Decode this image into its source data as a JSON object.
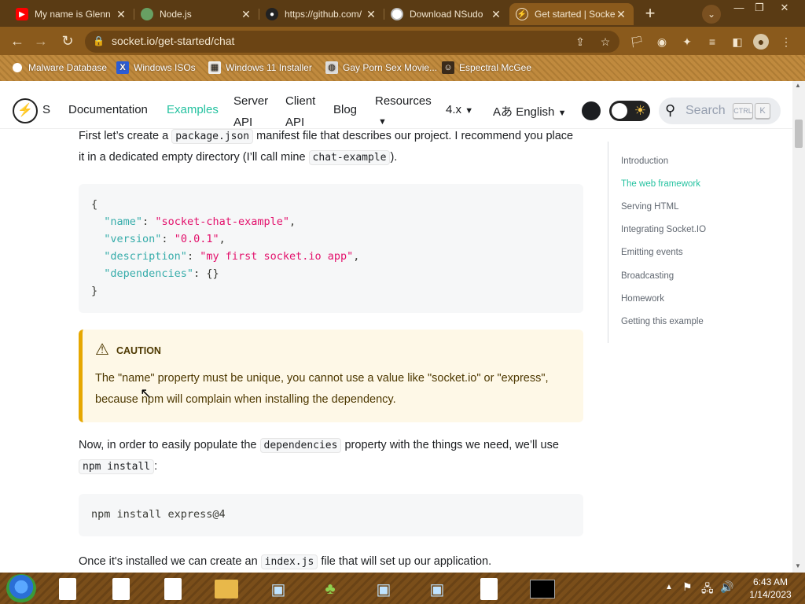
{
  "browser": {
    "tabs": [
      {
        "title": "My name is Glenn",
        "icon": "youtube-icon",
        "color": "#ff0000"
      },
      {
        "title": "Node.js",
        "icon": "nodejs-icon",
        "color": "#68a063"
      },
      {
        "title": "https://github.com/",
        "icon": "github-icon",
        "color": "#222222"
      },
      {
        "title": "Download NSudo",
        "icon": "chrome-icon",
        "color": "#ffffff"
      },
      {
        "title": "Get started | Socket.IO",
        "icon": "socketio-icon",
        "color": "#ffffff"
      }
    ],
    "new_tab": "+",
    "url": "socket.io/get-started/chat",
    "bookmarks": [
      "Malware Database",
      "Windows ISOs",
      "Windows 11 Installer",
      "Gay Porn Sex Movie...",
      "Espectral McGee"
    ]
  },
  "site": {
    "logo_letter": "S",
    "nav": {
      "documentation": "Documentation",
      "examples": "Examples",
      "server_api_1": "Server",
      "server_api_2": "API",
      "client_api_1": "Client",
      "client_api_2": "API",
      "blog": "Blog",
      "resources": "Resources",
      "version": "4.x",
      "language": "English"
    },
    "search_placeholder": "Search",
    "search_kbd": [
      "CTRL",
      "K"
    ]
  },
  "content": {
    "p1": {
      "a": "First let’s create a ",
      "code1": "package.json",
      "b": " manifest file that describes our project. I recommend you place",
      "c": "it in a dedicated empty directory (I’ll call mine ",
      "code2": "chat-example",
      "d": ")."
    },
    "code_json": {
      "l1": "{",
      "l2_key": "\"name\"",
      "l2_val": "\"socket-chat-example\"",
      "l3_key": "\"version\"",
      "l3_val": "\"0.0.1\"",
      "l4_key": "\"description\"",
      "l4_val": "\"my first socket.io app\"",
      "l5_key": "\"dependencies\"",
      "l5_val": "{}",
      "l6": "}"
    },
    "caution": {
      "title": "CAUTION",
      "line1": "The \"name\" property must be unique, you cannot use a value like \"socket.io\" or \"express\",",
      "line2": "because npm will complain when installing the dependency."
    },
    "p2": {
      "a": "Now, in order to easily populate the ",
      "code1": "dependencies",
      "b": " property with the things we need, we’ll use",
      "code2": "npm install",
      "c": ":"
    },
    "code_install": "npm install express@4",
    "p3": {
      "a": "Once it's installed we can create an ",
      "code1": "index.js",
      "b": " file that will set up our application."
    }
  },
  "toc": {
    "items": [
      "Introduction",
      "The web framework",
      "Serving HTML",
      "Integrating Socket.IO",
      "Emitting events",
      "Broadcasting",
      "Homework",
      "Getting this example"
    ],
    "active_index": 1,
    "active_color": "#25c2a0"
  },
  "taskbar": {
    "time": "6:43 AM",
    "date": "1/14/2023"
  }
}
